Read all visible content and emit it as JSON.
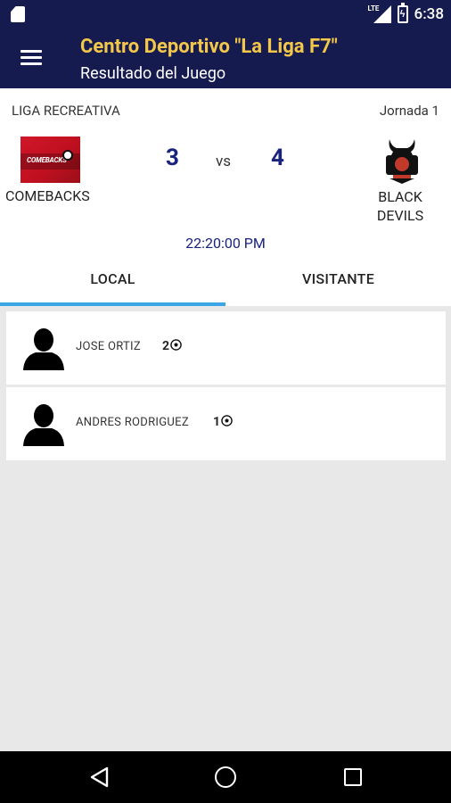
{
  "status_bar": {
    "time": "6:38",
    "network": "LTE"
  },
  "header": {
    "title": "Centro Deportivo \"La Liga F7\"",
    "subtitle": "Resultado del Juego"
  },
  "match": {
    "league": "LIGA RECREATIVA",
    "round": "Jornada 1",
    "home_team": {
      "name": "COMEBACKS",
      "score": "3",
      "logo_text": "COMEBACKS"
    },
    "vs_label": "VS",
    "away_team": {
      "name": "BLACK\nDEVILS",
      "score": "4"
    },
    "time": "22:20:00 PM"
  },
  "tabs": [
    {
      "label": "LOCAL",
      "active": true
    },
    {
      "label": "VISITANTE",
      "active": false
    }
  ],
  "scorers": [
    {
      "name": "JOSE  ORTIZ",
      "goals": "2"
    },
    {
      "name": "ANDRES RODRIGUEZ",
      "goals": "1"
    }
  ],
  "colors": {
    "primary": "#151a4f",
    "accent": "#f2c74a",
    "tab_indicator": "#3aa6e8",
    "score": "#1a237e"
  }
}
